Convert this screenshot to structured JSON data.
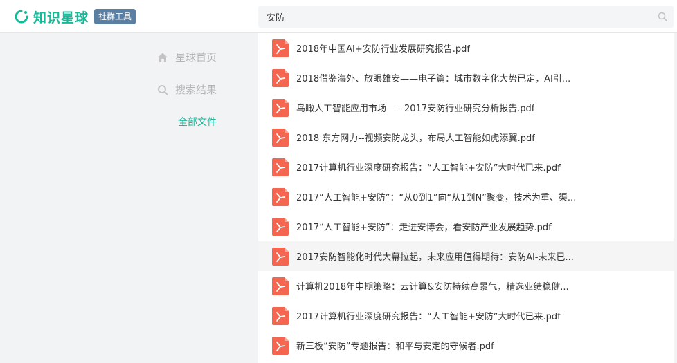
{
  "header": {
    "logo_text": "知识星球",
    "badge": "社群工具",
    "brand_color": "#16b998"
  },
  "search": {
    "value": "安防",
    "icon": "search-icon"
  },
  "sidebar": {
    "items": [
      {
        "label": "星球首页",
        "icon": "home-icon"
      },
      {
        "label": "搜索结果",
        "icon": "search-icon"
      },
      {
        "label": "全部文件",
        "active": true
      }
    ]
  },
  "files": [
    {
      "title": "2018年中国AI+安防行业发展研究报告.pdf"
    },
    {
      "title": "2018借鉴海外、放眼雄安——电子篇：城市数字化大势已定，AI引..."
    },
    {
      "title": "鸟瞰人工智能应用市场——2017安防行业研究分析报告.pdf"
    },
    {
      "title": "2018 东方网力--视频安防龙头，布局人工智能如虎添翼.pdf"
    },
    {
      "title": "2017计算机行业深度研究报告：“人工智能+安防”大时代已来.pdf"
    },
    {
      "title": "2017“人工智能+安防”：“从0到1”向“从1到N”聚变，技术为重、渠..."
    },
    {
      "title": "2017“人工智能+安防”：走进安博会，看安防产业发展趋势.pdf"
    },
    {
      "title": "2017安防智能化时代大幕拉起，未来应用值得期待：安防AI-未来已...",
      "hovered": true
    },
    {
      "title": "计算机2018年中期策略：云计算&安防持续高景气，精选业绩稳健..."
    },
    {
      "title": "2017计算机行业深度研究报告：“人工智能+安防”大时代已来.pdf"
    },
    {
      "title": "新三板“安防”专题报告：和平与安定的守候者.pdf"
    }
  ]
}
